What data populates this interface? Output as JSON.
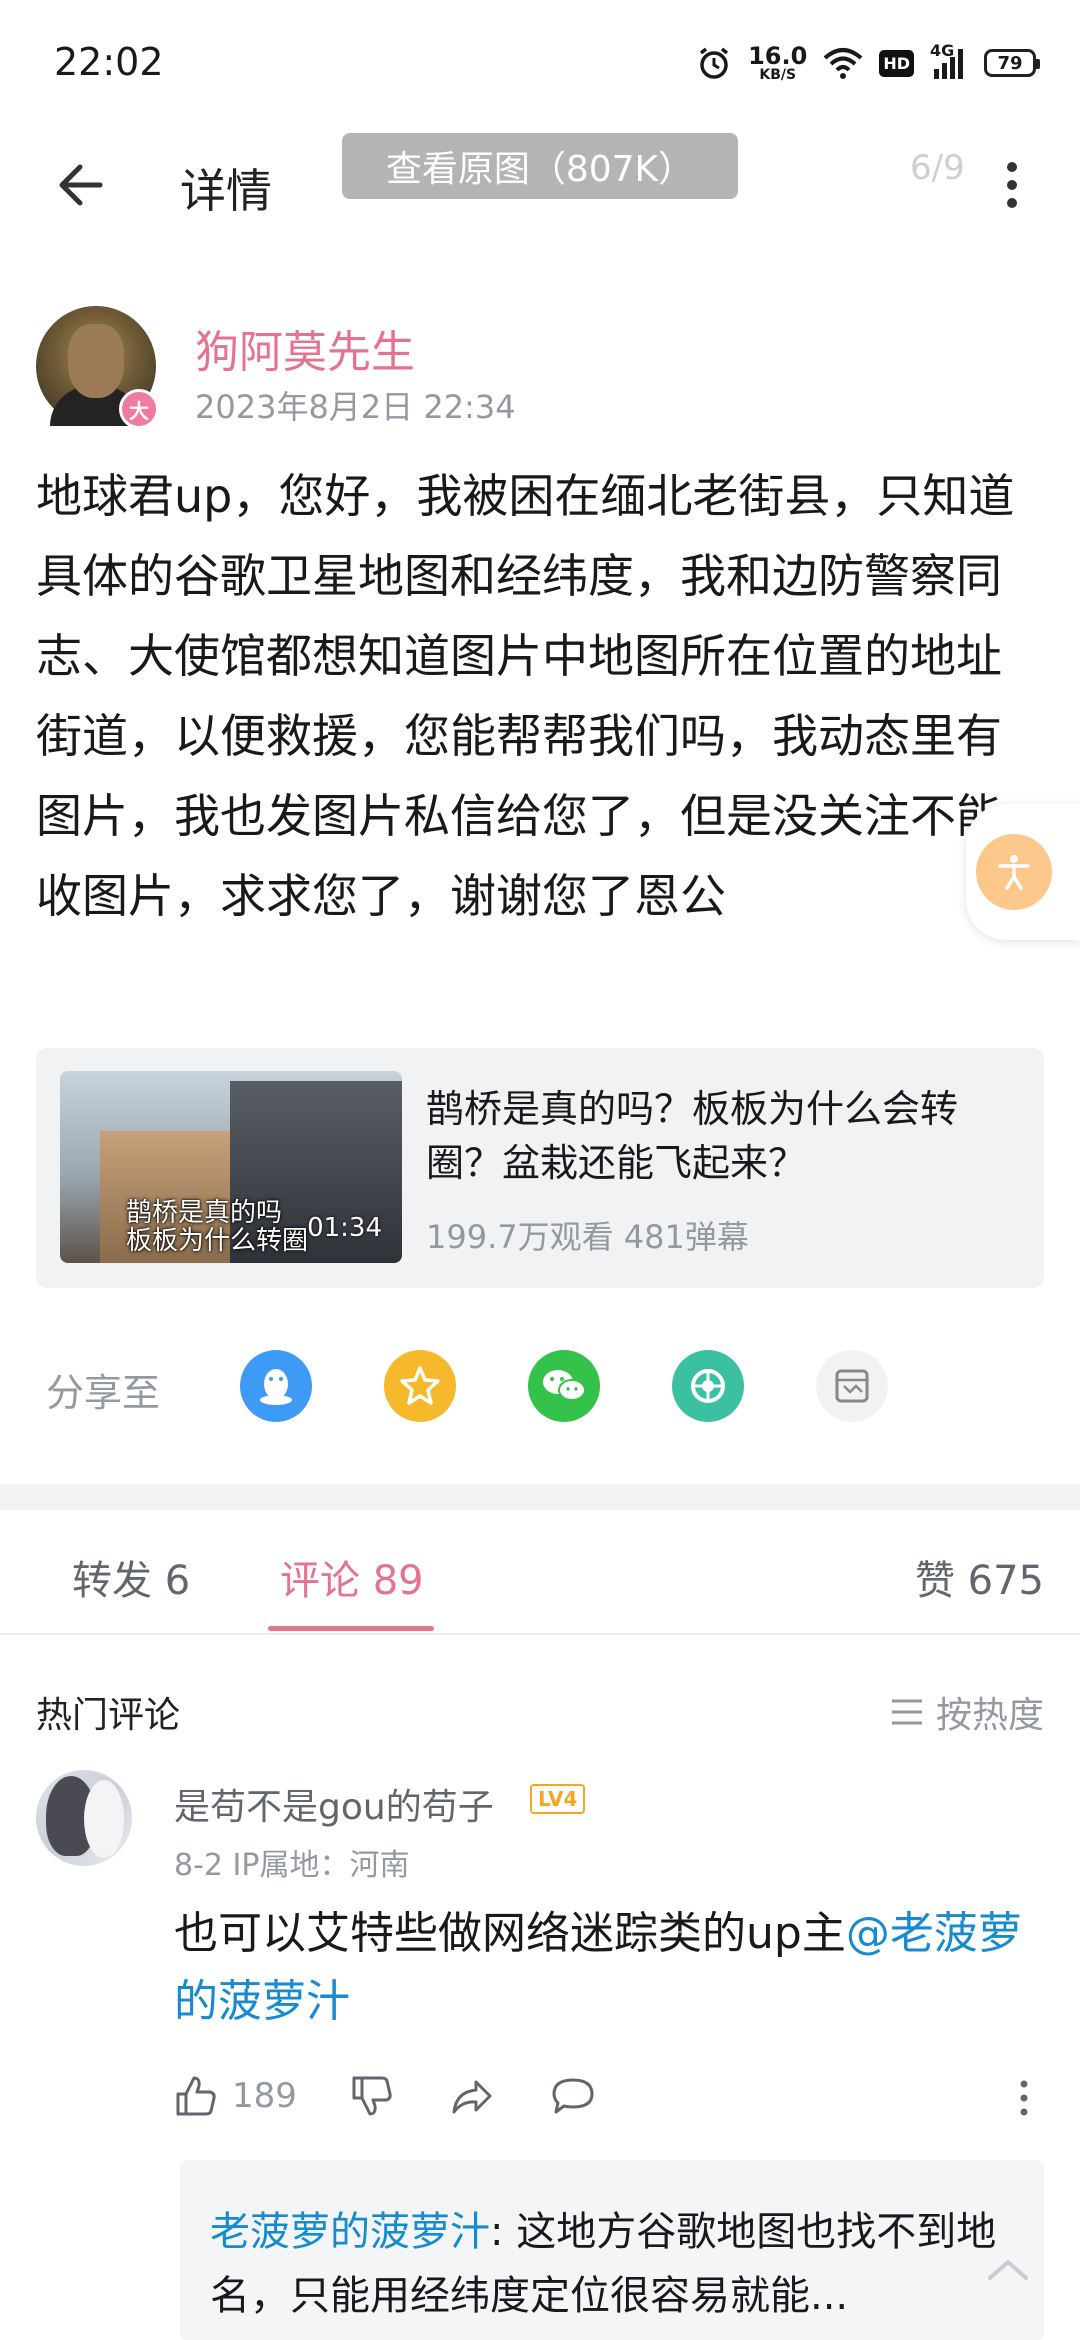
{
  "status_bar": {
    "time": "22:02",
    "net_speed": "16.0",
    "net_speed_unit": "KB/S",
    "hd": "HD",
    "network": "4G",
    "battery": "79"
  },
  "nav": {
    "title": "详情",
    "view_original": "查看原图（807K）",
    "page_indicator": "6/9"
  },
  "post": {
    "author": "狗阿莫先生",
    "badge": "大",
    "time": "2023年8月2日 22:34",
    "text": "地球君up，您好，我被困在缅北老街县，只知道具体的谷歌卫星地图和经纬度，我和边防警察同志、大使馆都想知道图片中地图所在位置的地址街道，以便救援，您能帮帮我们吗，我动态里有图片，我也发图片私信给您了，但是没关注不能收图片，求求您了，谢谢您了恩公"
  },
  "video": {
    "title": "鹊桥是真的吗？板板为什么会转圈？盆栽还能飞起来？",
    "thumb_caption_1": "鹊桥是真的吗",
    "thumb_caption_2": "板板为什么转圈",
    "duration": "01:34",
    "meta": "199.7万观看 481弹幕"
  },
  "share": {
    "label": "分享至",
    "targets": [
      "qq-icon",
      "qzone-icon",
      "wechat-icon",
      "moments-icon",
      "dynamic-icon"
    ]
  },
  "tabs": {
    "forward": "转发 6",
    "comments": "评论 89",
    "likes": "赞 675"
  },
  "comments_header": {
    "hot": "热门评论",
    "sort": "按热度"
  },
  "comment": {
    "user": "是苟不是gou的苟子",
    "level": "LV4",
    "meta": "8-2  IP属地：河南",
    "text_before": "也可以艾特些做网络迷踪类的up主",
    "mention": "@老菠萝的菠萝汁",
    "likes": "189",
    "reply": {
      "user": "老菠萝的菠萝汁",
      "text": ": 这地方谷歌地图也找不到地名，只能用经纬度定位很容易就能..."
    }
  },
  "colors": {
    "accent_pink": "#e4738f",
    "link_blue": "#178bcf",
    "muted": "#9499a0"
  }
}
